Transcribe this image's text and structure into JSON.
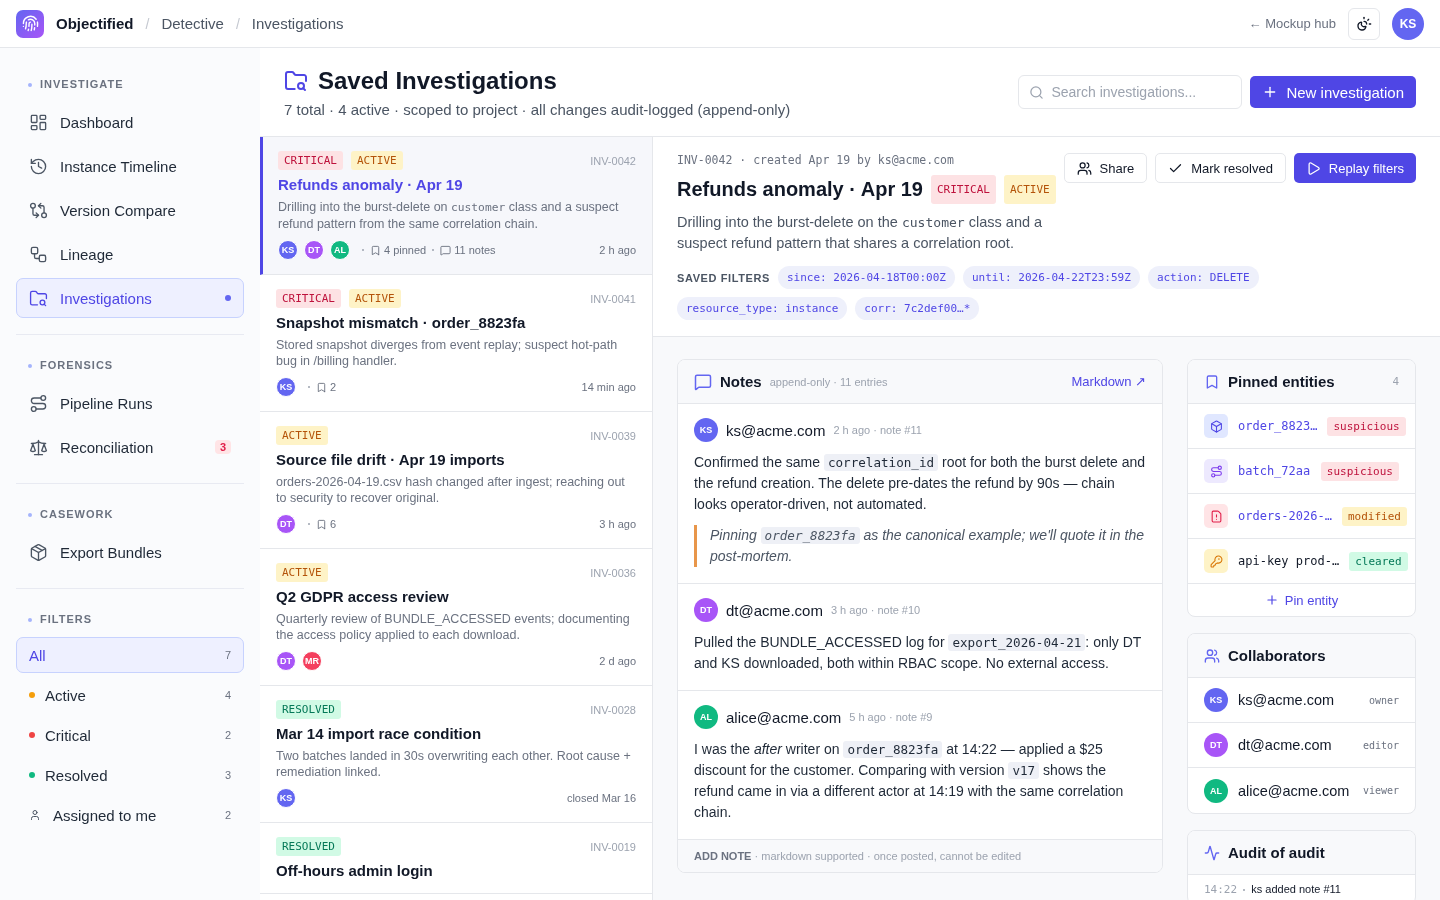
{
  "topbar": {
    "separator": "/",
    "breadcrumbs": [
      {
        "label": "Objectified",
        "kind": "root"
      },
      {
        "label": "Detective",
        "kind": "crumb"
      },
      {
        "label": "Investigations",
        "kind": "crumb"
      }
    ],
    "hub_link": "← Mockup hub",
    "user_initials": "KS"
  },
  "sidebar": {
    "sections": [
      {
        "title": "INVESTIGATE",
        "kind": "nav",
        "items": [
          {
            "label": "Dashboard",
            "selected": false
          },
          {
            "label": "Instance Timeline",
            "selected": false
          },
          {
            "label": "Version Compare",
            "selected": false
          },
          {
            "label": "Lineage",
            "selected": false
          },
          {
            "label": "Investigations",
            "selected": true
          }
        ]
      },
      {
        "title": "FORENSICS",
        "kind": "nav",
        "items": [
          {
            "label": "Pipeline Runs",
            "selected": false
          },
          {
            "label": "Reconciliation",
            "selected": false,
            "badge": "3"
          }
        ]
      },
      {
        "title": "CASEWORK",
        "kind": "nav",
        "items": [
          {
            "label": "Export Bundles",
            "selected": false
          }
        ]
      },
      {
        "title": "FILTERS",
        "kind": "filter",
        "items": [
          {
            "label": "All",
            "kind": "plain",
            "count": "7",
            "selected": true
          },
          {
            "label": "Active",
            "kind": "dot",
            "color": "#f59e0b",
            "count": "4",
            "selected": false
          },
          {
            "label": "Critical",
            "kind": "dot",
            "color": "#ef4444",
            "count": "2",
            "selected": false
          },
          {
            "label": "Resolved",
            "kind": "dot",
            "color": "#10b981",
            "count": "3",
            "selected": false
          },
          {
            "label": "Assigned to me",
            "kind": "person",
            "count": "2",
            "selected": false
          }
        ]
      }
    ]
  },
  "header": {
    "title": "Saved Investigations",
    "subtitle": "7 total · 4 active · scoped to project · all changes audit-logged (append-only)",
    "search_placeholder": "Search investigations...",
    "new_button": "New investigation"
  },
  "investigations": [
    {
      "selected": true,
      "id": "INV-0042",
      "tags": [
        {
          "label": "CRITICAL",
          "kind": "critical"
        },
        {
          "label": "ACTIVE",
          "kind": "active"
        }
      ],
      "title": "Refunds anomaly · Apr 19",
      "description": [
        {
          "kind": "text",
          "text": "Drilling into the burst-delete on "
        },
        {
          "kind": "code",
          "text": "customer"
        },
        {
          "kind": "text",
          "text": " class and a suspect refund pattern from the same correlation chain."
        }
      ],
      "avatars": [
        {
          "initials": "KS",
          "color": "#6366f1"
        },
        {
          "initials": "DT",
          "color": "#a855f7"
        },
        {
          "initials": "AL",
          "color": "#10b981"
        }
      ],
      "pinned": "4 pinned",
      "notes": "11 notes",
      "time": "2 h ago"
    },
    {
      "selected": false,
      "id": "INV-0041",
      "tags": [
        {
          "label": "CRITICAL",
          "kind": "critical"
        },
        {
          "label": "ACTIVE",
          "kind": "active"
        }
      ],
      "title": "Snapshot mismatch · order_8823fa",
      "description": [
        {
          "kind": "text",
          "text": "Stored snapshot diverges from event replay; suspect hot-path bug in /billing handler."
        }
      ],
      "avatars": [
        {
          "initials": "KS",
          "color": "#6366f1"
        }
      ],
      "pinned": "2",
      "time": "14 min ago"
    },
    {
      "selected": false,
      "id": "INV-0039",
      "tags": [
        {
          "label": "ACTIVE",
          "kind": "active"
        }
      ],
      "title": "Source file drift · Apr 19 imports",
      "description": [
        {
          "kind": "text",
          "text": "orders-2026-04-19.csv hash changed after ingest; reaching out to security to recover original."
        }
      ],
      "avatars": [
        {
          "initials": "DT",
          "color": "#a855f7"
        }
      ],
      "pinned": "6",
      "time": "3 h ago"
    },
    {
      "selected": false,
      "id": "INV-0036",
      "tags": [
        {
          "label": "ACTIVE",
          "kind": "active"
        }
      ],
      "title": "Q2 GDPR access review",
      "description": [
        {
          "kind": "text",
          "text": "Quarterly review of BUNDLE_ACCESSED events; documenting the access policy applied to each download."
        }
      ],
      "avatars": [
        {
          "initials": "DT",
          "color": "#a855f7"
        },
        {
          "initials": "MR",
          "color": "#f43f5e"
        }
      ],
      "time": "2 d ago"
    },
    {
      "selected": false,
      "id": "INV-0028",
      "tags": [
        {
          "label": "RESOLVED",
          "kind": "resolved"
        }
      ],
      "title": "Mar 14 import race condition",
      "description": [
        {
          "kind": "text",
          "text": "Two batches landed in 30s overwriting each other. Root cause + remediation linked."
        }
      ],
      "avatars": [
        {
          "initials": "KS",
          "color": "#6366f1"
        }
      ],
      "time": "closed Mar 16"
    },
    {
      "selected": false,
      "id": "INV-0019",
      "tags": [
        {
          "label": "RESOLVED",
          "kind": "resolved"
        }
      ],
      "title": "Off-hours admin login"
    }
  ],
  "detail": {
    "meta": "INV-0042 · created Apr 19 by ks@acme.com",
    "title": "Refunds anomaly · Apr 19",
    "tags": [
      {
        "label": "CRITICAL",
        "kind": "critical"
      },
      {
        "label": "ACTIVE",
        "kind": "active"
      }
    ],
    "description": [
      {
        "kind": "text",
        "text": "Drilling into the burst-delete on the "
      },
      {
        "kind": "code",
        "text": "customer"
      },
      {
        "kind": "text",
        "text": " class and a suspect refund pattern that shares a correlation root."
      }
    ],
    "actions": [
      {
        "label": "Share",
        "kind": "share"
      },
      {
        "label": "Mark resolved",
        "kind": "resolve"
      },
      {
        "label": "Replay filters",
        "kind": "primary"
      }
    ],
    "filters_label": "SAVED FILTERS",
    "filters": [
      "since: 2026-04-18T00:00Z",
      "until: 2026-04-22T23:59Z",
      "action: DELETE",
      "resource_type: instance",
      "corr: 7c2def00…*"
    ]
  },
  "notes": {
    "title": "Notes",
    "subtitle": "append-only · 11 entries",
    "link": "Markdown ↗",
    "entries": [
      {
        "author": "ks@acme.com",
        "initials": "KS",
        "color": "#6366f1",
        "meta": "2 h ago · note #11",
        "body": [
          {
            "kind": "text",
            "text": "Confirmed the same "
          },
          {
            "kind": "code",
            "text": "correlation_id"
          },
          {
            "kind": "text",
            "text": " root for both the burst delete and the refund creation. The delete pre-dates the refund by 90s — chain looks operator-driven, not automated."
          }
        ],
        "quote": [
          {
            "kind": "text",
            "text": "Pinning "
          },
          {
            "kind": "code",
            "text": "order_8823fa"
          },
          {
            "kind": "text",
            "text": " as the canonical example; we'll quote it in the post-mortem."
          }
        ]
      },
      {
        "author": "dt@acme.com",
        "initials": "DT",
        "color": "#a855f7",
        "meta": "3 h ago · note #10",
        "body": [
          {
            "kind": "text",
            "text": "Pulled the BUNDLE_ACCESSED log for "
          },
          {
            "kind": "code",
            "text": "export_2026-04-21"
          },
          {
            "kind": "text",
            "text": ": only DT and KS downloaded, both within RBAC scope. No external access."
          }
        ]
      },
      {
        "author": "alice@acme.com",
        "initials": "AL",
        "color": "#10b981",
        "meta": "5 h ago · note #9",
        "body": [
          {
            "kind": "text",
            "text": "I was the *after* writer on "
          },
          {
            "kind": "code",
            "text": "order_8823fa"
          },
          {
            "kind": "text",
            "text": " at 14:22 — applied a $25 discount for the customer. Comparing with version "
          },
          {
            "kind": "code",
            "text": "v17"
          },
          {
            "kind": "text",
            "text": " shows the refund came in via a different actor at 14:19 with the same correlation chain."
          }
        ]
      }
    ],
    "footer": "**ADD NOTE** · markdown supported · once posted, cannot be edited"
  },
  "pinned": {
    "title": "Pinned entities",
    "count": "4",
    "entities": [
      {
        "name": "order_8823…",
        "kind": "instance",
        "tag": {
          "label": "suspicious",
          "kind": "critical"
        }
      },
      {
        "name": "batch_72aa",
        "kind": "batch",
        "tag": {
          "label": "suspicious",
          "kind": "critical"
        }
      },
      {
        "name": "orders-2026-…",
        "kind": "file",
        "tag": {
          "label": "modified",
          "kind": "active"
        }
      },
      {
        "name": "api-key prod-…",
        "kind": "key",
        "tag": {
          "label": "cleared",
          "kind": "resolved"
        }
      }
    ],
    "add": "Pin entity"
  },
  "collaborators": {
    "title": "Collaborators",
    "people": [
      {
        "initials": "KS",
        "color": "#6366f1",
        "email": "ks@acme.com",
        "role": "owner"
      },
      {
        "initials": "DT",
        "color": "#a855f7",
        "email": "dt@acme.com",
        "role": "editor"
      },
      {
        "initials": "AL",
        "color": "#10b981",
        "email": "alice@acme.com",
        "role": "viewer"
      }
    ]
  },
  "audit": {
    "title": "Audit of audit",
    "entries": [
      {
        "time": "14:22",
        "text": "ks added note #11"
      }
    ]
  }
}
